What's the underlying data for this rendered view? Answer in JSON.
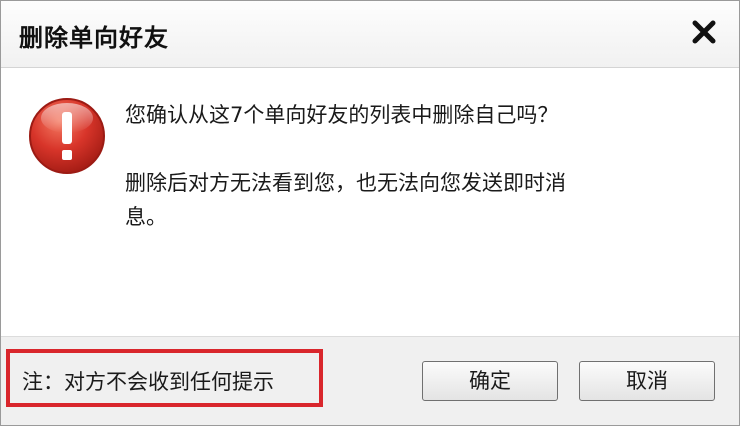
{
  "dialog": {
    "title": "删除单向好友",
    "close_icon": "close-icon"
  },
  "message": {
    "icon": "error-exclamation-icon",
    "line1": "您确认从这7个单向好友的列表中删除自己吗？",
    "line2": "删除后对方无法看到您，也无法向您发送即时消息。"
  },
  "footer": {
    "note": "注：对方不会收到任何提示",
    "ok_label": "确定",
    "cancel_label": "取消"
  },
  "colors": {
    "note_highlight": "#d9262c",
    "icon_red": "#d8352a"
  }
}
